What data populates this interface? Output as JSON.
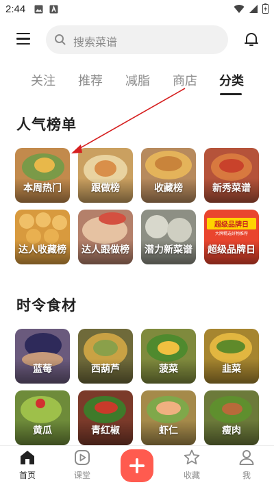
{
  "status_bar": {
    "time": "2:44"
  },
  "search": {
    "placeholder": "搜索菜谱"
  },
  "tabs": [
    {
      "label": "关注",
      "active": false
    },
    {
      "label": "推荐",
      "active": false
    },
    {
      "label": "减脂",
      "active": false
    },
    {
      "label": "商店",
      "active": false
    },
    {
      "label": "分类",
      "active": true
    }
  ],
  "popular": {
    "title": "人气榜单",
    "items": [
      {
        "label": "本周热门",
        "color": "#c28a4c"
      },
      {
        "label": "跟做榜",
        "color": "#caa060"
      },
      {
        "label": "收藏榜",
        "color": "#b78a5d"
      },
      {
        "label": "新秀菜谱",
        "color": "#b5533a"
      },
      {
        "label": "达人收藏榜",
        "color": "#d89a3e"
      },
      {
        "label": "达人跟做榜",
        "color": "#b4806a"
      },
      {
        "label": "潜力新菜谱",
        "color": "#8d8f84"
      },
      {
        "label": "超级品牌日",
        "color": "#e9452e",
        "promo": "超级品牌日",
        "promo_sub": "大牌精选好物推荐"
      }
    ]
  },
  "seasonal": {
    "title": "时令食材",
    "items": [
      {
        "label": "蓝莓",
        "color": "#6a5a7d"
      },
      {
        "label": "西葫芦",
        "color": "#6f6a3a"
      },
      {
        "label": "菠菜",
        "color": "#7f8a3d"
      },
      {
        "label": "韭菜",
        "color": "#a6852f"
      },
      {
        "label": "黄瓜",
        "color": "#6e8b3a"
      },
      {
        "label": "青红椒",
        "color": "#7b3a2a"
      },
      {
        "label": "虾仁",
        "color": "#a58a4a"
      },
      {
        "label": "瘦肉",
        "color": "#6c7a3a"
      }
    ]
  },
  "bottom_nav": {
    "home": "首页",
    "class": "课堂",
    "favorite": "收藏",
    "me": "我"
  },
  "colors": {
    "accent_red": "#ff5b4f",
    "annotation_arrow": "#d62020"
  }
}
